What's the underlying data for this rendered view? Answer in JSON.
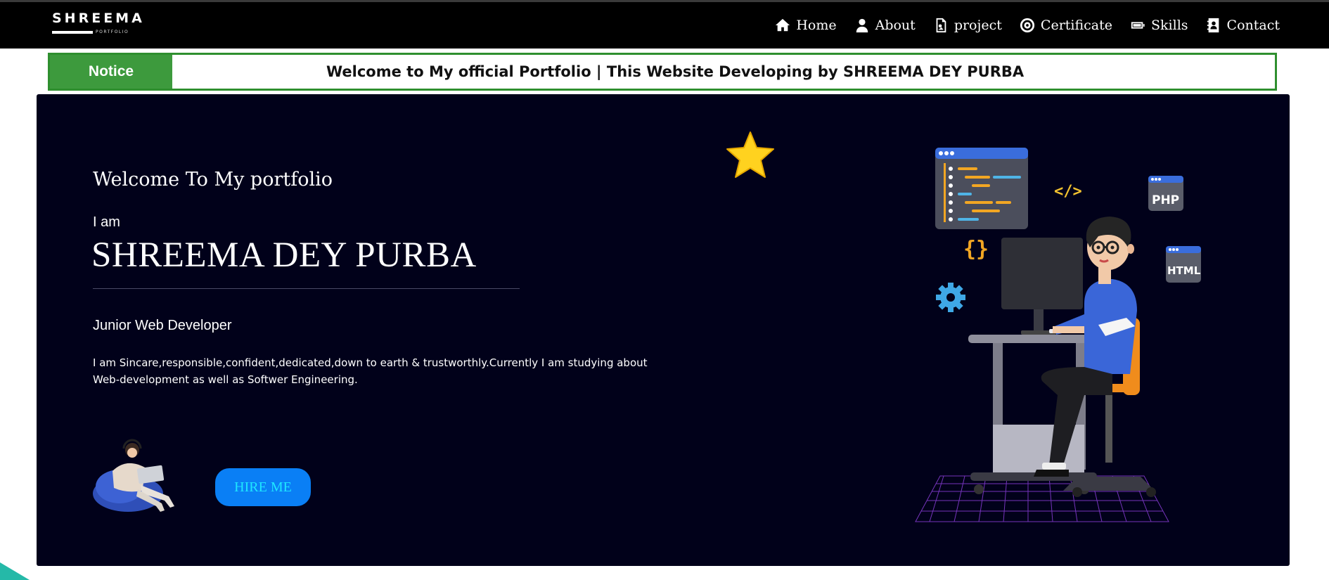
{
  "brand": {
    "name": "SHREEMA",
    "subtitle": "PORTFOLIO"
  },
  "nav": [
    {
      "label": "Home",
      "icon": "home-icon"
    },
    {
      "label": "About",
      "icon": "user-icon"
    },
    {
      "label": "project",
      "icon": "file-icon"
    },
    {
      "label": "Certificate",
      "icon": "target-icon"
    },
    {
      "label": "Skills",
      "icon": "battery-icon"
    },
    {
      "label": "Contact",
      "icon": "contact-book-icon"
    }
  ],
  "notice": {
    "label": "Notice",
    "text": "Welcome to My official Portfolio | This Website Developing by SHREEMA DEY PURBA"
  },
  "hero": {
    "welcome": "Welcome To My portfolio",
    "intro": "I am",
    "name": "SHREEMA DEY PURBA",
    "role": "Junior Web Developer",
    "bio": "I am Sincare,responsible,confident,dedicated,down to earth & trustworthly.Currently I am studying about Web-development as well as Softwer Engineering.",
    "cta": "HIRE ME"
  },
  "illustration": {
    "tags": [
      "PHP",
      "HTML",
      "</>",
      "{}"
    ]
  },
  "colors": {
    "topbar": "#000000",
    "notice_accent": "#3d9a3d",
    "hero_bg": "#01011a",
    "cta_bg": "#0a7ff5",
    "cta_text": "#1ee6ff"
  }
}
